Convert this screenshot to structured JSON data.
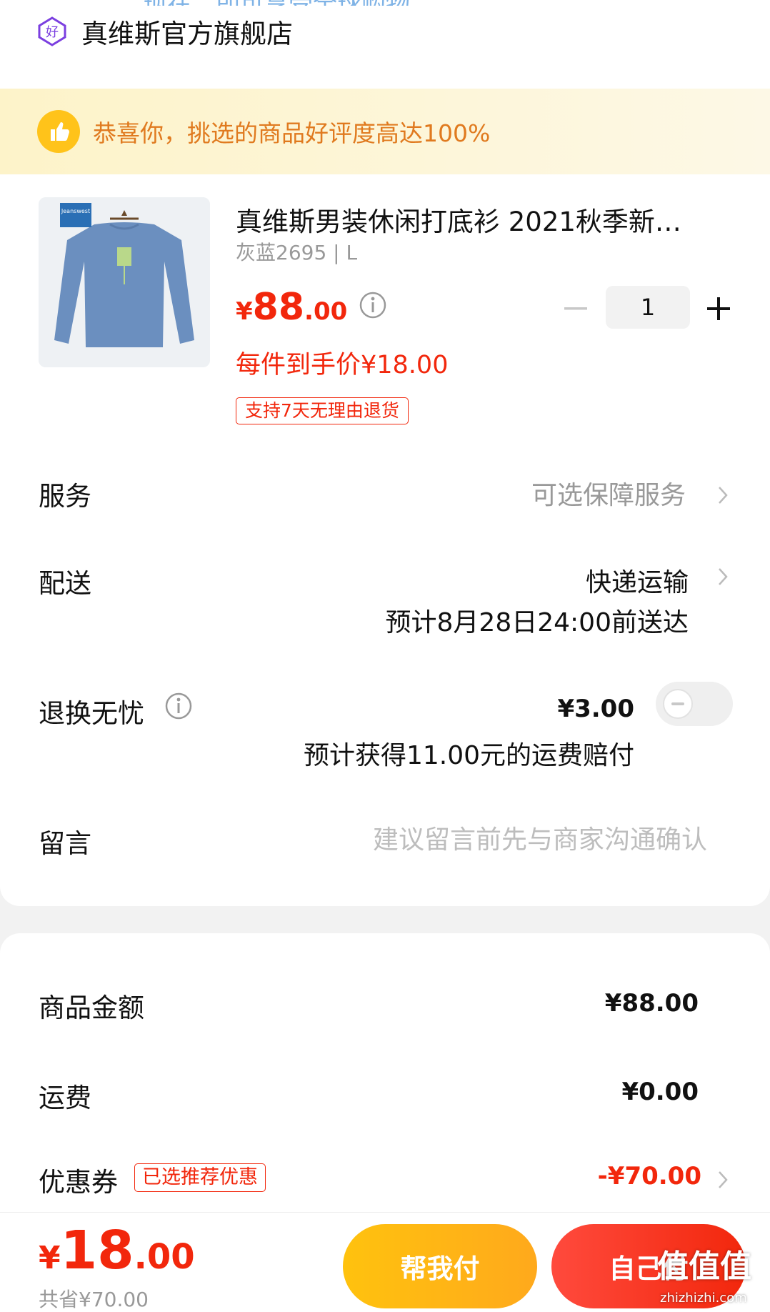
{
  "header": {
    "cut_text": "现在，即可享受全球购物",
    "store_name": "真维斯官方旗舰店",
    "store_icon": "good-store-badge-icon"
  },
  "banner": {
    "text": "恭喜你，挑选的商品好评度高达100%",
    "icon": "thumbs-up-icon"
  },
  "product": {
    "title": "真维斯男装休闲打底衫 2021秋季新…",
    "variant": "灰蓝2695 | L",
    "price_currency": "¥",
    "price_int": "88",
    "price_dec": ".00",
    "net_price": "每件到手价¥18.00",
    "tag": "支持7天无理由退货",
    "quantity": "1",
    "image_brand_text": "Jeanswest"
  },
  "rows": {
    "service_label": "服务",
    "service_value": "可选保障服务",
    "delivery_label": "配送",
    "delivery_value": "快递运输",
    "delivery_sub": "预计8月28日24:00前送达",
    "return_label": "退换无忧",
    "return_value": "¥3.00",
    "return_sub": "预计获得11.00元的运费赔付",
    "message_label": "留言",
    "message_placeholder": "建议留言前先与商家沟通确认"
  },
  "summary": {
    "goods_label": "商品金额",
    "goods_value": "¥88.00",
    "shipping_label": "运费",
    "shipping_value": "¥0.00",
    "coupon_label": "优惠券",
    "coupon_tag": "已选推荐优惠",
    "coupon_value": "-¥70.00"
  },
  "bottom": {
    "total_currency": "¥",
    "total_int": "18",
    "total_dec": ".00",
    "saved": "共省¥70.00",
    "help_pay": "帮我付",
    "self_pay": "自己付"
  },
  "watermark": {
    "big": "值值值",
    "small": "zhizhizhi.com"
  },
  "colors": {
    "accent_red": "#f2270c",
    "accent_yellow": "#ffc20e",
    "banner_text": "#e07a1f"
  }
}
